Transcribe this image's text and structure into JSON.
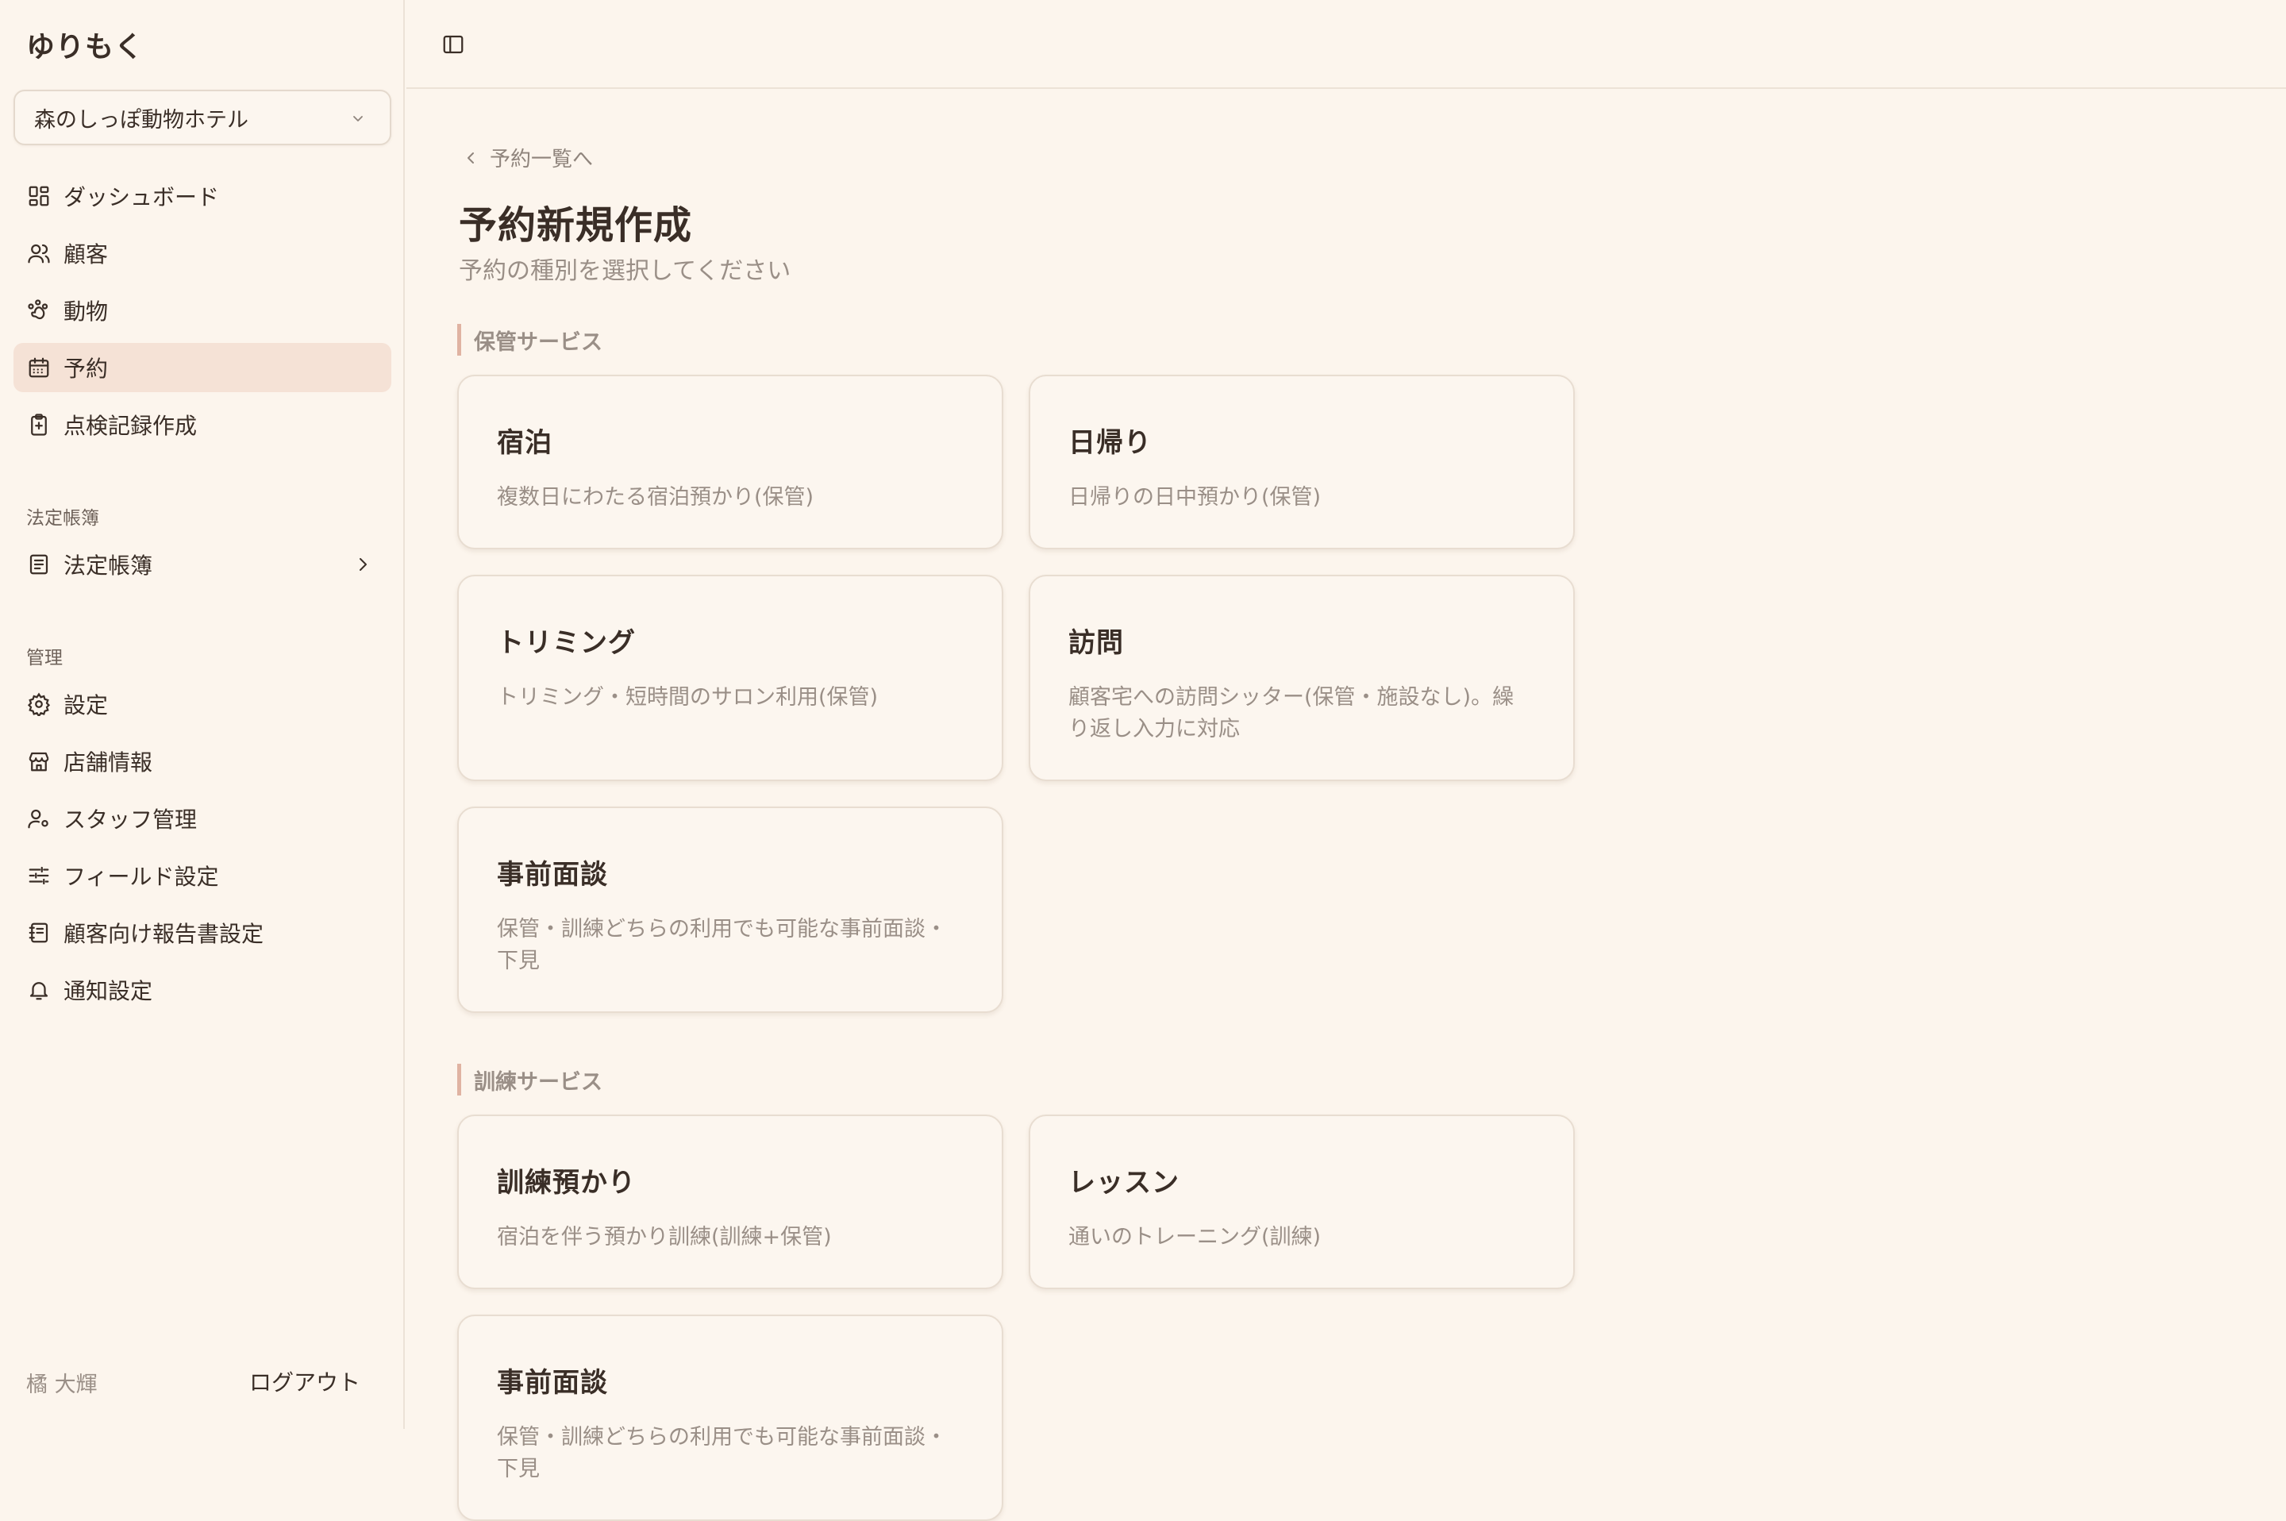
{
  "sidebar": {
    "brand": "ゆりもく",
    "store": "森のしっぽ動物ホテル",
    "items": [
      {
        "label": "ダッシュボード",
        "icon": "dashboard-icon"
      },
      {
        "label": "顧客",
        "icon": "users-icon"
      },
      {
        "label": "動物",
        "icon": "paw-icon"
      },
      {
        "label": "予約",
        "icon": "calendar-icon",
        "active": true
      },
      {
        "label": "点検記録作成",
        "icon": "clipboard-plus-icon"
      }
    ],
    "sections": {
      "ledger": {
        "label": "法定帳簿",
        "items": [
          {
            "label": "法定帳簿",
            "icon": "book-icon"
          }
        ]
      },
      "admin": {
        "label": "管理",
        "items": [
          {
            "label": "設定",
            "icon": "gear-icon"
          },
          {
            "label": "店舗情報",
            "icon": "store-icon"
          },
          {
            "label": "スタッフ管理",
            "icon": "user-cog-icon"
          },
          {
            "label": "フィールド設定",
            "icon": "sliders-icon"
          },
          {
            "label": "顧客向け報告書設定",
            "icon": "notebook-icon"
          },
          {
            "label": "通知設定",
            "icon": "bell-icon"
          }
        ]
      }
    },
    "user": "橘 大輝",
    "logout": "ログアウト"
  },
  "main": {
    "back": "予約一覧へ",
    "title": "予約新規作成",
    "subtitle": "予約の種別を選択してください",
    "groups": [
      {
        "label": "保管サービス",
        "cards": [
          {
            "title": "宿泊",
            "desc": "複数日にわたる宿泊預かり(保管)"
          },
          {
            "title": "日帰り",
            "desc": "日帰りの日中預かり(保管)"
          },
          {
            "title": "トリミング",
            "desc": "トリミング・短時間のサロン利用(保管)"
          },
          {
            "title": "訪問",
            "desc": "顧客宅への訪問シッター(保管・施設なし)。繰り返し入力に対応"
          },
          {
            "title": "事前面談",
            "desc": "保管・訓練どちらの利用でも可能な事前面談・下見"
          }
        ]
      },
      {
        "label": "訓練サービス",
        "cards": [
          {
            "title": "訓練預かり",
            "desc": "宿泊を伴う預かり訓練(訓練+保管)"
          },
          {
            "title": "レッスン",
            "desc": "通いのトレーニング(訓練)"
          },
          {
            "title": "事前面談",
            "desc": "保管・訓練どちらの利用でも可能な事前面談・下見"
          }
        ]
      }
    ]
  },
  "colors": {
    "background": "#fcf5ed",
    "active_nav": "#f5e2d6",
    "section_accent": "#e0b3a2",
    "text": "#3a2e27",
    "muted": "#9a8f87"
  }
}
